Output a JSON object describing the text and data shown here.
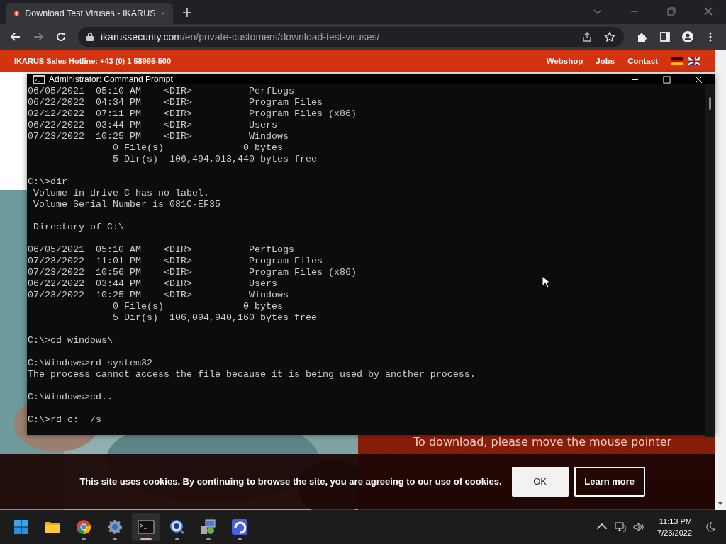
{
  "browser": {
    "tab": {
      "title": "Download Test Viruses - IKARUS",
      "selected": true
    },
    "nav": {
      "back_disabled": false,
      "forward_disabled": true
    },
    "address": {
      "host": "ikarussecurity.com",
      "path": "/en/private-customers/download-test-viruses/"
    }
  },
  "site": {
    "hotline": "IKARUS Sales Hotline: +43 (0) 1 58995-500",
    "links": [
      "Webshop",
      "Jobs",
      "Contact"
    ],
    "download_text": "To download, please move the mouse pointer"
  },
  "console": {
    "title": "Administrator: Command Prompt",
    "blocks": [
      [
        "06/05/2021  05:10 AM    <DIR>          PerfLogs",
        "06/22/2022  04:34 PM    <DIR>          Program Files",
        "02/12/2022  07:11 PM    <DIR>          Program Files (x86)",
        "06/22/2022  03:44 PM    <DIR>          Users",
        "07/23/2022  10:25 PM    <DIR>          Windows",
        "               0 File(s)              0 bytes",
        "               5 Dir(s)  106,494,013,440 bytes free"
      ],
      [
        "C:\\>dir",
        " Volume in drive C has no label.",
        " Volume Serial Number is 081C-EF35"
      ],
      [
        " Directory of C:\\"
      ],
      [
        "06/05/2021  05:10 AM    <DIR>          PerfLogs",
        "07/23/2022  11:01 PM    <DIR>          Program Files",
        "07/23/2022  10:56 PM    <DIR>          Program Files (x86)",
        "06/22/2022  03:44 PM    <DIR>          Users",
        "07/23/2022  10:25 PM    <DIR>          Windows",
        "               0 File(s)              0 bytes",
        "               5 Dir(s)  106,094,940,160 bytes free"
      ],
      [
        "C:\\>cd windows\\"
      ],
      [
        "C:\\Windows>rd system32",
        "The process cannot access the file because it is being used by another process."
      ],
      [
        "C:\\Windows>cd.."
      ],
      [
        "C:\\>rd c:  /s"
      ]
    ]
  },
  "cookie": {
    "message": "This site uses cookies. By continuing to browse the site, you are agreeing to our use of cookies.",
    "buttons": [
      {
        "label": "OK",
        "kind": "primary"
      },
      {
        "label": "Learn more",
        "kind": "outline"
      }
    ]
  },
  "taskbar": {
    "apps": [
      {
        "kind": "start",
        "selected": false,
        "running": false
      },
      {
        "kind": "folder",
        "selected": false,
        "running": false
      },
      {
        "kind": "browser",
        "selected": false,
        "running": true
      },
      {
        "kind": "settings",
        "selected": false,
        "running": true
      },
      {
        "kind": "terminal",
        "selected": true,
        "running": true
      },
      {
        "kind": "magnifier",
        "selected": false,
        "running": true
      },
      {
        "kind": "computer",
        "selected": false,
        "running": true
      },
      {
        "kind": "app",
        "selected": false,
        "running": true
      }
    ],
    "time": "11:13 PM",
    "date": "7/23/2022"
  }
}
